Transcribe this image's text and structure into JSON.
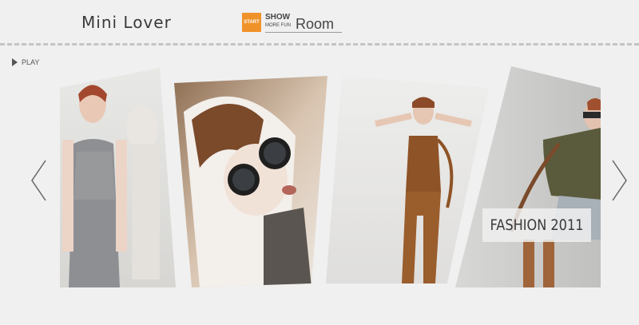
{
  "header": {
    "logo_text": "Mini Lover",
    "showroom": {
      "start_label": "START",
      "show_label": "SHOW",
      "more_label": "MORE FUN",
      "room_label": "Room"
    }
  },
  "controls": {
    "play_label": "PLAY",
    "prev_icon": "chevron-left-icon",
    "next_icon": "chevron-right-icon"
  },
  "gallery": {
    "caption": "FASHION 2011",
    "items": [
      {
        "subject": "model in grey knit dress beside mannequin"
      },
      {
        "subject": "model with dark round sunglasses and brown hood"
      },
      {
        "subject": "model in brown satin jumpsuit, arms raised"
      },
      {
        "subject": "model in olive jacket and sunglasses"
      }
    ]
  },
  "colors": {
    "accent": "#f0922a",
    "background": "#f0f0f0",
    "text": "#3a3a3a"
  }
}
